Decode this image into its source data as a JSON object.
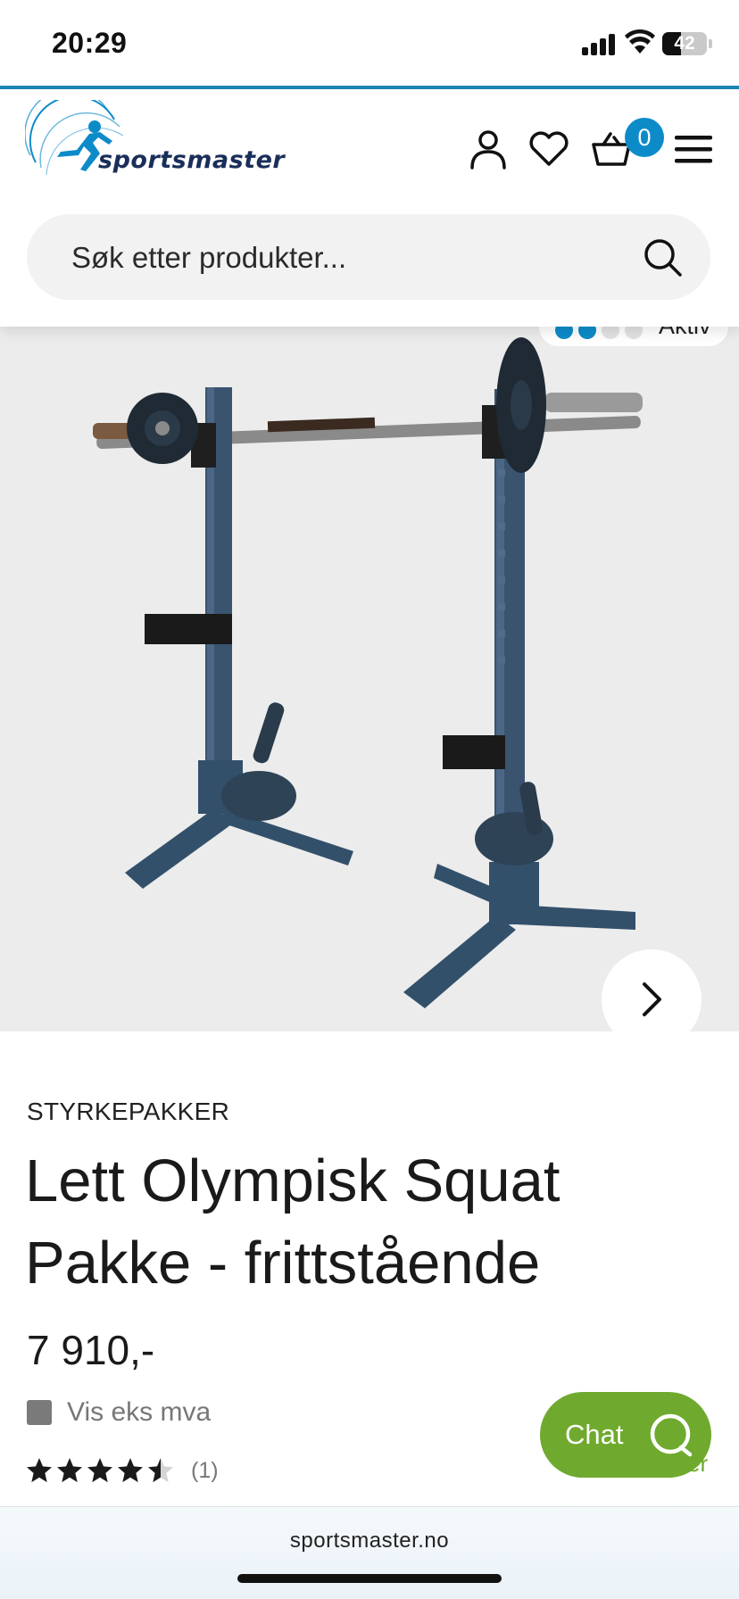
{
  "status_bar": {
    "time": "20:29",
    "battery": "42"
  },
  "header": {
    "logo_text": "sportsmaster",
    "cart_count": "0",
    "icons": [
      "user-icon",
      "heart-icon",
      "cart-icon",
      "menu-icon"
    ],
    "search_placeholder": "Søk etter produkter..."
  },
  "gallery": {
    "stock_label": "Aktiv",
    "stock_level": 0.5,
    "next_icon": "chevron-right-icon"
  },
  "product": {
    "category": "STYRKEPAKKER",
    "title": "Lett Olympisk Squat Pakke - frittstående",
    "price": "7 910,-",
    "vat_toggle_label": "Vis eks mva",
    "rating": 4.5,
    "review_count": "(1)"
  },
  "chat": {
    "label": "Chat",
    "peek_text": "er"
  },
  "browser": {
    "url": "sportsmaster.no"
  },
  "colors": {
    "accent": "#0d8bc9",
    "chat": "#6faa2e",
    "rack": "#33506b"
  }
}
